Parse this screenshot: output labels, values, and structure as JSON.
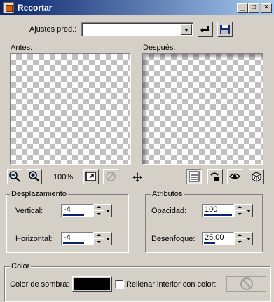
{
  "window": {
    "title": "Recortar",
    "controls": {
      "minimize": "_",
      "maximize": "□",
      "close": "×"
    },
    "title_icon": "crop-tool-icon"
  },
  "presets": {
    "label": "Ajustes pred.:",
    "value": "",
    "reset_icon": "undo-arrow-icon",
    "save_icon": "floppy-disk-icon"
  },
  "preview": {
    "before_label": "Antes:",
    "after_label": "Después:",
    "zoom_text": "100%",
    "icons": [
      "zoom-out-icon",
      "zoom-in-icon",
      "fit-window-icon",
      "proof-disabled-icon",
      "move-icon"
    ],
    "right_icons": [
      "toggle-preview-icon",
      "script-mode-icon",
      "eye-icon",
      "randomize-dice-icon"
    ]
  },
  "offset": {
    "title": "Desplazamiento",
    "vertical_label": "Vertical:",
    "vertical_value": "-4",
    "horizontal_label": "Horizontal:",
    "horizontal_value": "-4"
  },
  "attributes": {
    "title": "Atributos",
    "opacity_label": "Opacidad:",
    "opacity_value": "100",
    "blur_label": "Desenfoque:",
    "blur_value": "25,00"
  },
  "color": {
    "title": "Color",
    "shadow_label": "Color de sombra:",
    "shadow_color": "#000000",
    "fill_label": "Rellenar interior con color:",
    "fill_checked": false
  },
  "colors": {
    "titlebar": "#0a246a",
    "face": "#d4d0c8"
  }
}
